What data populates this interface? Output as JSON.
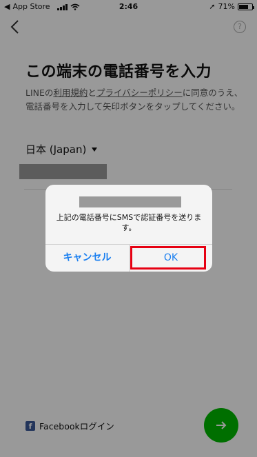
{
  "status_bar": {
    "carrier": "App Store",
    "time": "2:46",
    "battery_percent": "71%",
    "battery_level": 0.71
  },
  "screen": {
    "title": "この端末の電話番号を入力",
    "terms": {
      "prefix": "LINEの",
      "terms_link": "利用規約",
      "and": "と",
      "privacy_link": "プライバシーポリシー",
      "suffix": "に同意のうえ、電話番号を入力して矢印ボタンをタップしてください。"
    },
    "country": "日本 (Japan)",
    "facebook_login": "Facebookログイン",
    "help_glyph": "?"
  },
  "dialog": {
    "message": "上記の電話番号にSMSで認証番号を送ります。",
    "cancel_label": "キャンセル",
    "ok_label": "OK"
  },
  "colors": {
    "accent_green": "#00b900",
    "ios_blue": "#1a7ff0",
    "highlight_red": "#e60012",
    "facebook_blue": "#3b5998"
  },
  "icons": [
    "back-chevron-icon",
    "help-icon",
    "dropdown-caret-icon",
    "facebook-icon",
    "arrow-right-icon",
    "signal-icon",
    "wifi-icon",
    "battery-icon",
    "location-icon"
  ]
}
